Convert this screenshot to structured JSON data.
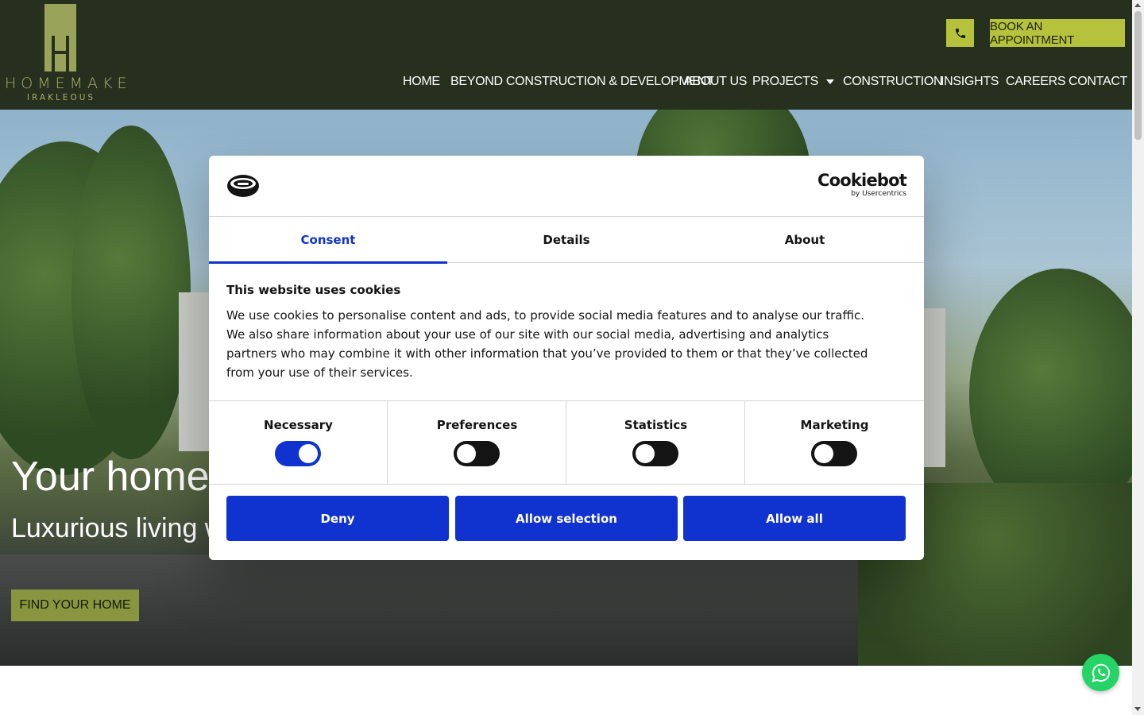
{
  "header": {
    "logo_name": "HOMEMAKE",
    "logo_sub": "IRAKLEOUS",
    "phone_icon": "phone-icon",
    "book_label": "BOOK AN APPOINTMENT",
    "nav": [
      {
        "label": "HOME"
      },
      {
        "label": "BEYOND CONSTRUCTION & DEVELOPMENT"
      },
      {
        "label": "ABOUT US"
      },
      {
        "label": "PROJECTS"
      },
      {
        "label": "CONSTRUCTION"
      },
      {
        "label": "INSIGHTS"
      },
      {
        "label": "CAREERS"
      },
      {
        "label": "CONTACT"
      }
    ]
  },
  "hero": {
    "title": "Your home, ",
    "subtitle": "Luxurious living w",
    "cta": "FIND YOUR HOME"
  },
  "cookie": {
    "brand": "Cookiebot",
    "brand_sub": "by Usercentrics",
    "tabs": [
      "Consent",
      "Details",
      "About"
    ],
    "active_tab": "Consent",
    "title": "This website uses cookies",
    "text": "We use cookies to personalise content and ads, to provide social media features and to analyse our traffic. We also share information about your use of our site with our social media, advertising and analytics partners who may combine it with other information that you’ve provided to them or that they’ve collected from your use of their services.",
    "toggles": [
      {
        "label": "Necessary",
        "on": true
      },
      {
        "label": "Preferences",
        "on": false
      },
      {
        "label": "Statistics",
        "on": false
      },
      {
        "label": "Marketing",
        "on": false
      }
    ],
    "buttons": {
      "deny": "Deny",
      "allow_selection": "Allow selection",
      "allow_all": "Allow all"
    }
  },
  "whatsapp_icon": "whatsapp-icon",
  "colors": {
    "header_bg": "#27301f",
    "accent": "#b7c23c",
    "cookie_blue": "#1032cf",
    "whatsapp": "#25d366"
  }
}
